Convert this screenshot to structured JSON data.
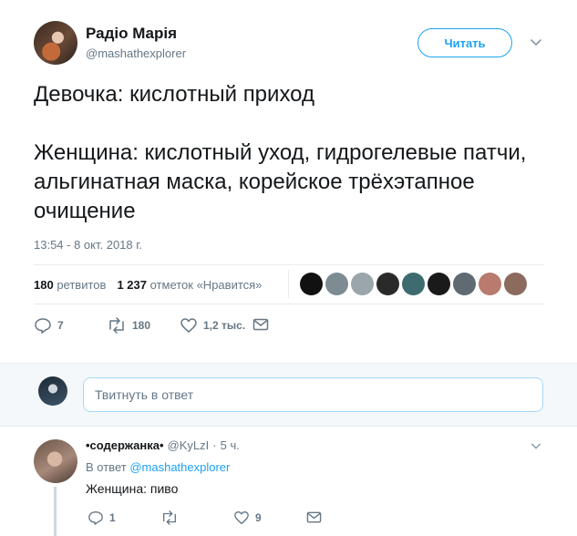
{
  "tweet": {
    "author_name": "Радіо Марія",
    "author_handle": "@mashathexplorer",
    "follow_label": "Читать",
    "paragraph1": "Девочка: кислотный приход",
    "paragraph2": "Женщина: кислотный уход, гидрогелевые патчи, альгинатная маска, корейское трёхэтапное очищение",
    "timestamp": "13:54 - 8 окт. 2018 г.",
    "retweets_count": "180",
    "retweets_label": "ретвитов",
    "likes_count": "1 237",
    "likes_label": "отметок «Нравится»",
    "likers_colors": [
      "#111111",
      "#7d8b93",
      "#9aa6aa",
      "#2a2a2a",
      "#3e6b6e",
      "#1a1a1a",
      "#606a72",
      "#b97b6d",
      "#8c6b5e"
    ]
  },
  "actions": {
    "reply_count": "7",
    "retweet_count": "180",
    "like_count": "1,2 тыс."
  },
  "composer": {
    "placeholder": "Твитнуть в ответ"
  },
  "reply": {
    "name": "•содержанка•",
    "handle": "@KyLzI",
    "dot": "·",
    "time": "5 ч.",
    "replying_prefix": "В ответ",
    "replying_handle": "@mashathexplorer",
    "text": "Женщина: пиво",
    "reply_count": "1",
    "retweet_count": "",
    "like_count": "9"
  },
  "colors": {
    "accent": "#1da1f2",
    "muted": "#657786",
    "text": "#14171a"
  }
}
